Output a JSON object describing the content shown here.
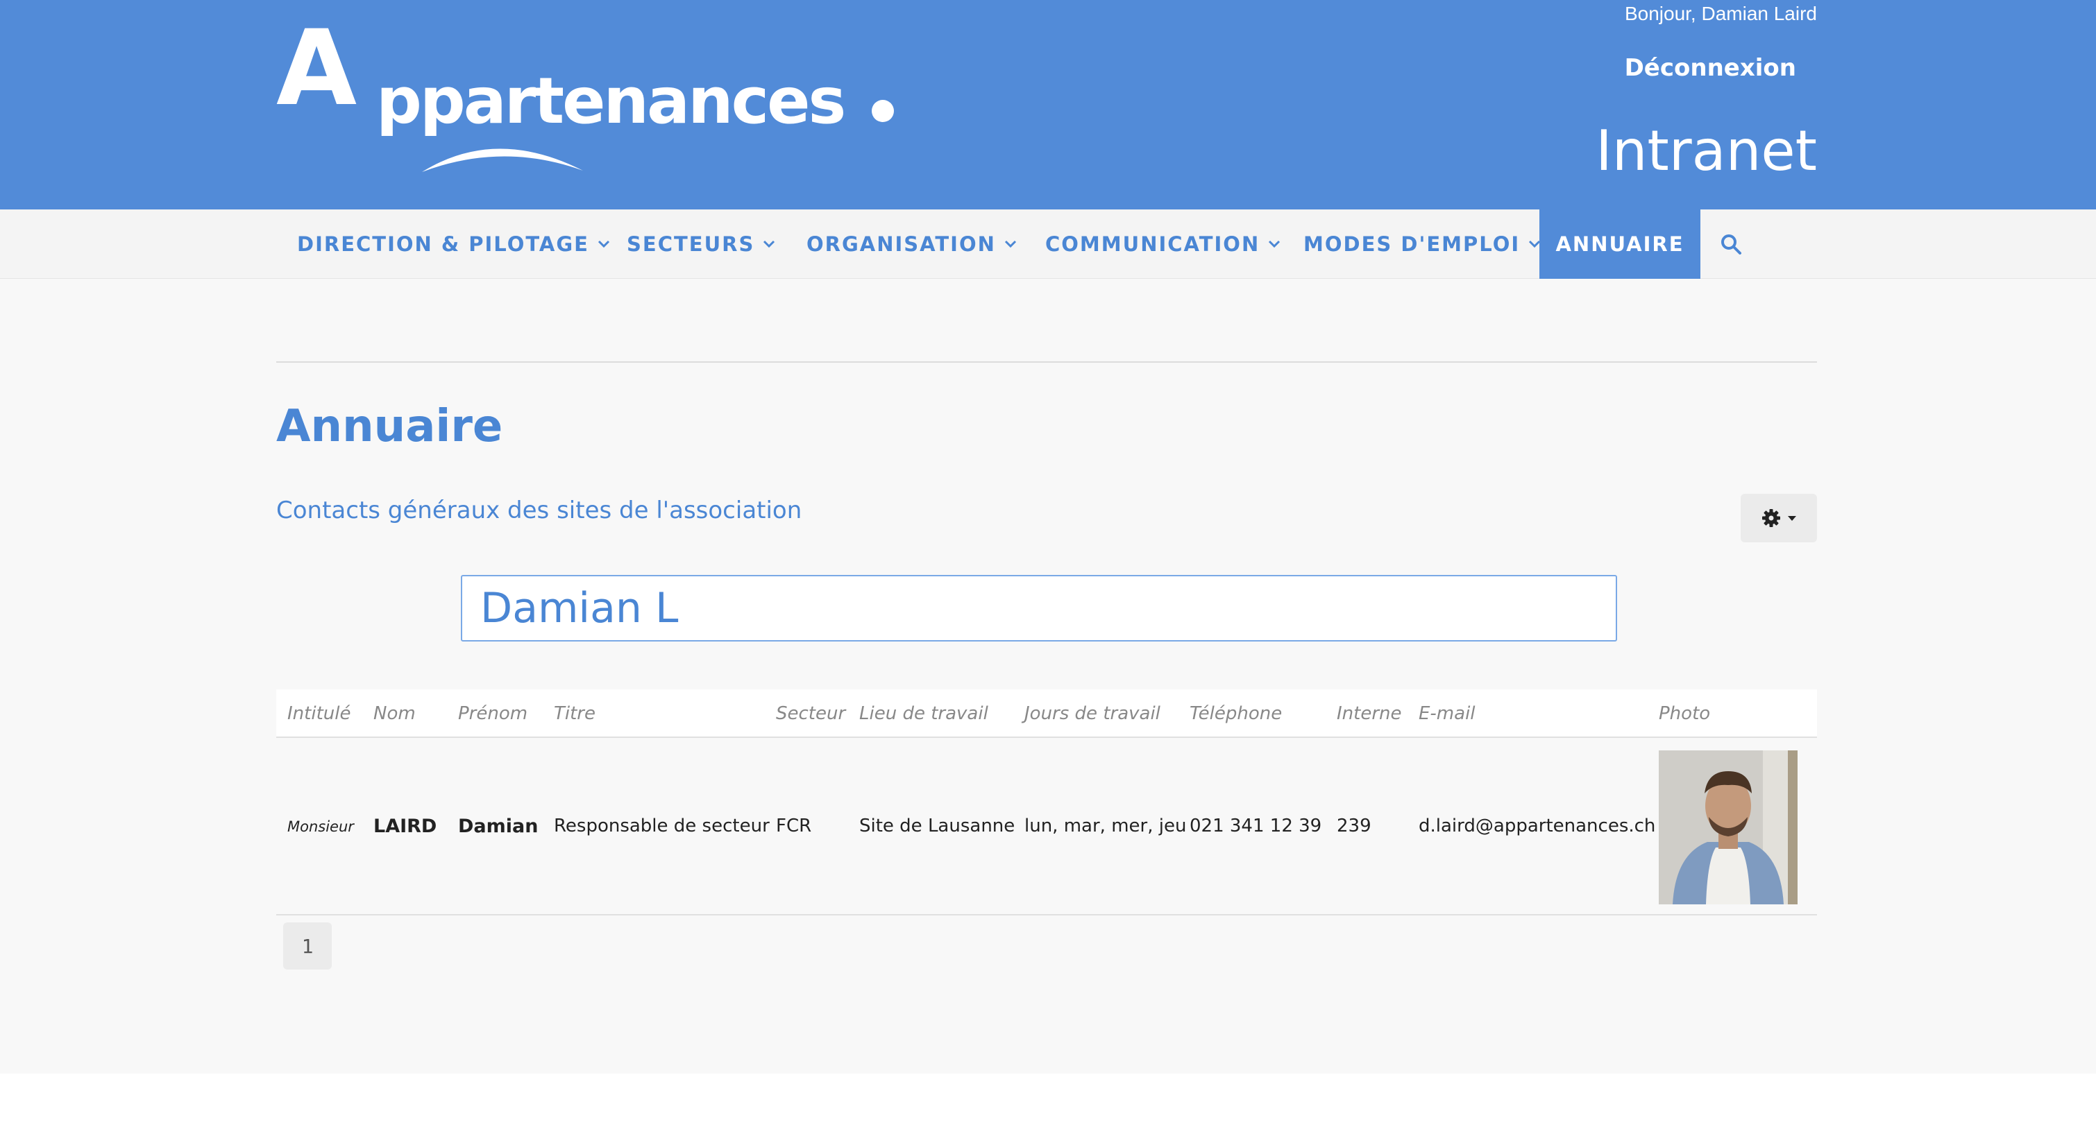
{
  "header": {
    "logo_letter": "A",
    "logo_word": "ppartenances",
    "greeting": "Bonjour, Damian Laird",
    "logout_label": "Déconnexion",
    "site_title": "Intranet",
    "brand_color": "#528bd8"
  },
  "nav": {
    "items": [
      {
        "label": "DIRECTION & PILOTAGE",
        "has_dropdown": true
      },
      {
        "label": "SECTEURS",
        "has_dropdown": true
      },
      {
        "label": "ORGANISATION",
        "has_dropdown": true
      },
      {
        "label": "COMMUNICATION",
        "has_dropdown": true
      },
      {
        "label": "MODES D'EMPLOI",
        "has_dropdown": true
      },
      {
        "label": "ANNUAIRE",
        "has_dropdown": false,
        "active": true
      }
    ],
    "search_icon": "search-icon"
  },
  "main": {
    "title": "Annuaire",
    "subtitle": "Contacts généraux des sites de l'association",
    "settings_icon": "gear-icon",
    "search_value": "Damian L"
  },
  "table": {
    "headers": [
      "Intitulé",
      "Nom",
      "Prénom",
      "Titre",
      "Secteur",
      "Lieu de travail",
      "Jours de travail",
      "Téléphone",
      "Interne",
      "E-mail",
      "Photo"
    ],
    "rows": [
      {
        "intitule": "Monsieur",
        "nom": "LAIRD",
        "prenom": "Damian",
        "titre": "Responsable de secteur",
        "secteur": "FCR",
        "lieu": "Site de Lausanne",
        "jours": "lun, mar, mer, jeu",
        "telephone": "021 341 12 39",
        "interne": "239",
        "email": "d.laird@appartenances.ch"
      }
    ]
  },
  "pagination": {
    "current_page": "1"
  }
}
